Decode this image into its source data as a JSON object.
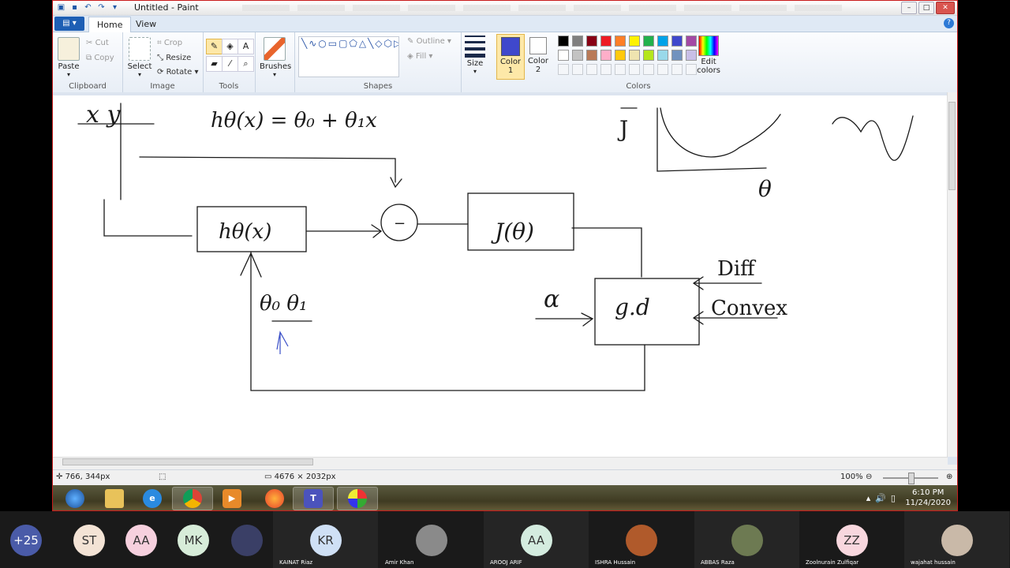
{
  "window": {
    "title": "Untitled - Paint"
  },
  "tabs": {
    "file": "▤ ▾",
    "home": "Home",
    "view": "View"
  },
  "help": "?",
  "ribbon": {
    "clipboard": {
      "paste": "Paste",
      "cut": "Cut",
      "copy": "Copy",
      "label": "Clipboard"
    },
    "image": {
      "select": "Select",
      "crop": "Crop",
      "resize": "Resize",
      "rotate": "Rotate",
      "label": "Image"
    },
    "tools": {
      "label": "Tools"
    },
    "brushes": {
      "label": "Brushes"
    },
    "shapes": {
      "outline": "Outline",
      "fill": "Fill",
      "label": "Shapes",
      "glyphs": "╲∿○▭▢⬠△╲◇⬡▷⇨⇩⇦⇧✦☆✡▭◯◯⇨"
    },
    "size": {
      "label": "Size"
    },
    "color1": {
      "label_line1": "Color",
      "label_line2": "1",
      "value": "#3f48cc"
    },
    "color2": {
      "label_line1": "Color",
      "label_line2": "2",
      "value": "#ffffff"
    },
    "palette_row1": [
      "#000000",
      "#7f7f7f",
      "#880015",
      "#ed1c24",
      "#ff7f27",
      "#fff200",
      "#22b14c",
      "#00a2e8",
      "#3f48cc",
      "#a349a4"
    ],
    "palette_row2": [
      "#ffffff",
      "#c3c3c3",
      "#b97a57",
      "#ffaec9",
      "#ffc90e",
      "#efe4b0",
      "#b5e61d",
      "#99d9ea",
      "#7092be",
      "#c8bfe7"
    ],
    "edit_colors": {
      "line1": "Edit",
      "line2": "colors"
    },
    "colors_label": "Colors"
  },
  "status": {
    "cursor": "766, 344px",
    "canvas_size": "4676 × 2032px",
    "zoom": "100%"
  },
  "taskbar": {
    "time": "6:10 PM",
    "date": "11/24/2020"
  },
  "participants": [
    {
      "initials": "+25",
      "name": "",
      "color": "#4a5ba8"
    },
    {
      "initials": "ST",
      "name": "",
      "color": "#f3e3d5"
    },
    {
      "initials": "AA",
      "name": "",
      "color": "#f6d0de"
    },
    {
      "initials": "MK",
      "name": "",
      "color": "#d7ecd9"
    },
    {
      "initials": "",
      "name": "",
      "color": "#3a3f66"
    },
    {
      "initials": "KR",
      "name": "KAINAT  Riaz",
      "color": "#cfe0f5"
    },
    {
      "initials": "",
      "name": "Amir  Khan",
      "color": "#8a8a8a"
    },
    {
      "initials": "AA",
      "name": "AROOJ ARIF",
      "color": "#d4ecdf"
    },
    {
      "initials": "",
      "name": "ISHRA  Hussain",
      "color": "#b05a2b"
    },
    {
      "initials": "",
      "name": "ABBAS  Raza",
      "color": "#6d7a52"
    },
    {
      "initials": "ZZ",
      "name": "Zoolnurain  Zulfiqar",
      "color": "#f8d7de"
    },
    {
      "initials": "",
      "name": "wajahat hussain",
      "color": "#c9b9a8"
    }
  ],
  "drawing": {
    "xy": "x y",
    "hypothesis": "hθ(x) = θ₀ + θ₁x",
    "j_label": "J",
    "theta_axis": "θ",
    "h_box": "hθ(x)",
    "minus": "−",
    "j_box": "J(θ)",
    "gd_box": "g.d",
    "alpha": "α",
    "diff": "Diff",
    "convex": "Convex",
    "theta_params": "θ₀ θ₁"
  }
}
